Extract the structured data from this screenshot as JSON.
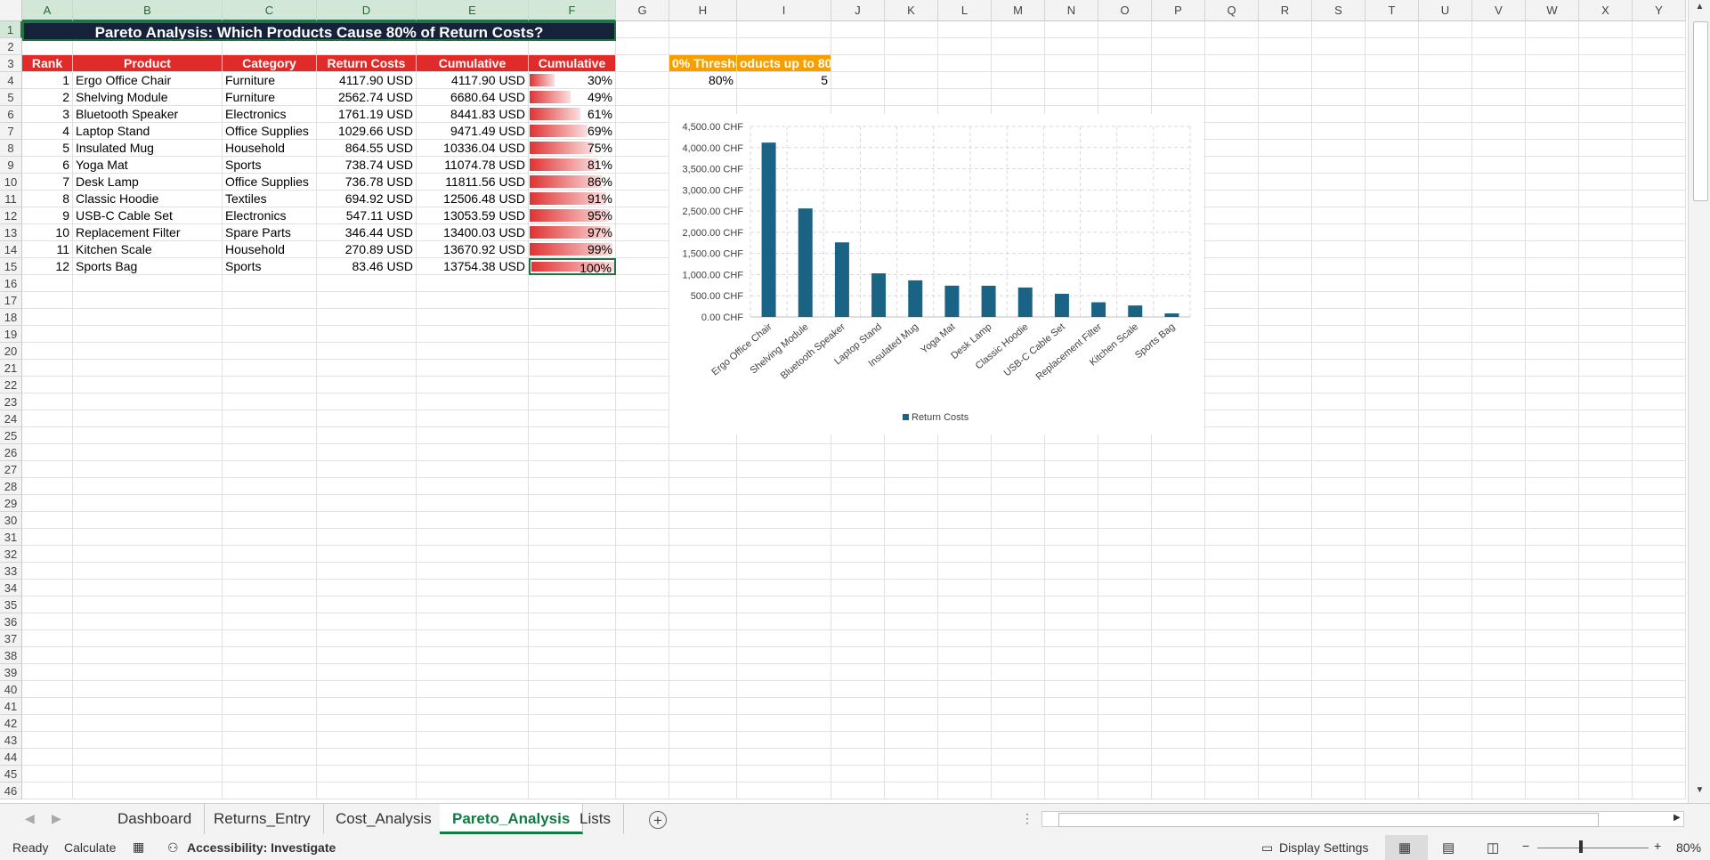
{
  "columns": [
    "A",
    "B",
    "C",
    "D",
    "E",
    "F",
    "G",
    "H",
    "I",
    "J",
    "K",
    "L",
    "M",
    "N",
    "O",
    "P",
    "Q",
    "R",
    "S",
    "T",
    "U",
    "V",
    "W",
    "X",
    "Y"
  ],
  "title": "Pareto Analysis: Which Products Cause 80% of Return Costs?",
  "headers": [
    "Rank",
    "Product",
    "Category",
    "Return Costs",
    "Cumulative",
    "Cumulative"
  ],
  "rows": [
    {
      "rank": "1",
      "product": "Ergo Office Chair",
      "category": "Furniture",
      "cost": "4117.90 USD",
      "cumulative": "4117.90 USD",
      "pct": "30%",
      "pct_value": 0.3
    },
    {
      "rank": "2",
      "product": "Shelving Module",
      "category": "Furniture",
      "cost": "2562.74 USD",
      "cumulative": "6680.64 USD",
      "pct": "49%",
      "pct_value": 0.49
    },
    {
      "rank": "3",
      "product": "Bluetooth Speaker",
      "category": "Electronics",
      "cost": "1761.19 USD",
      "cumulative": "8441.83 USD",
      "pct": "61%",
      "pct_value": 0.61
    },
    {
      "rank": "4",
      "product": "Laptop Stand",
      "category": "Office Supplies",
      "cost": "1029.66 USD",
      "cumulative": "9471.49 USD",
      "pct": "69%",
      "pct_value": 0.69
    },
    {
      "rank": "5",
      "product": "Insulated Mug",
      "category": "Household",
      "cost": "864.55 USD",
      "cumulative": "10336.04 USD",
      "pct": "75%",
      "pct_value": 0.75
    },
    {
      "rank": "6",
      "product": "Yoga Mat",
      "category": "Sports",
      "cost": "738.74 USD",
      "cumulative": "11074.78 USD",
      "pct": "81%",
      "pct_value": 0.81
    },
    {
      "rank": "7",
      "product": "Desk Lamp",
      "category": "Office Supplies",
      "cost": "736.78 USD",
      "cumulative": "11811.56 USD",
      "pct": "86%",
      "pct_value": 0.86
    },
    {
      "rank": "8",
      "product": "Classic Hoodie",
      "category": "Textiles",
      "cost": "694.92 USD",
      "cumulative": "12506.48 USD",
      "pct": "91%",
      "pct_value": 0.91
    },
    {
      "rank": "9",
      "product": "USB-C Cable Set",
      "category": "Electronics",
      "cost": "547.11 USD",
      "cumulative": "13053.59 USD",
      "pct": "95%",
      "pct_value": 0.95
    },
    {
      "rank": "10",
      "product": "Replacement Filter",
      "category": "Spare Parts",
      "cost": "346.44 USD",
      "cumulative": "13400.03 USD",
      "pct": "97%",
      "pct_value": 0.97
    },
    {
      "rank": "11",
      "product": "Kitchen Scale",
      "category": "Household",
      "cost": "270.89 USD",
      "cumulative": "13670.92 USD",
      "pct": "99%",
      "pct_value": 0.99
    },
    {
      "rank": "12",
      "product": "Sports Bag",
      "category": "Sports",
      "cost": "83.46 USD",
      "cumulative": "13754.38 USD",
      "pct": "100%",
      "pct_value": 1.0
    }
  ],
  "threshold": {
    "header_h": "0% Thresho",
    "header_i": "oducts up to 80",
    "value_h": "80%",
    "value_i": "5"
  },
  "colors": {
    "title_bg": "#15223a",
    "header_red": "#e02b2b",
    "header_orange": "#f5a000",
    "bar": "#1b6384",
    "accent": "#107c41"
  },
  "chart_data": {
    "type": "bar",
    "categories": [
      "Ergo Office Chair",
      "Shelving Module",
      "Bluetooth Speaker",
      "Laptop Stand",
      "Insulated Mug",
      "Yoga Mat",
      "Desk Lamp",
      "Classic Hoodie",
      "USB-C Cable Set",
      "Replacement Filter",
      "Kitchen Scale",
      "Sports Bag"
    ],
    "series": [
      {
        "name": "Return Costs",
        "values": [
          4117.9,
          2562.74,
          1761.19,
          1029.66,
          864.55,
          738.74,
          736.78,
          694.92,
          547.11,
          346.44,
          270.89,
          83.46
        ]
      }
    ],
    "y_ticks": [
      "0.00 CHF",
      "500.00 CHF",
      "1,000.00 CHF",
      "1,500.00 CHF",
      "2,000.00 CHF",
      "2,500.00 CHF",
      "3,000.00 CHF",
      "3,500.00 CHF",
      "4,000.00 CHF",
      "4,500.00 CHF"
    ],
    "ylim": [
      0,
      4500
    ],
    "grid": true,
    "legend": "bottom"
  },
  "sheet_tabs": [
    "Dashboard",
    "Returns_Entry",
    "Cost_Analysis",
    "Pareto_Analysis",
    "Lists"
  ],
  "active_tab": "Pareto_Analysis",
  "status": {
    "ready": "Ready",
    "calculate": "Calculate",
    "accessibility": "Accessibility: Investigate",
    "display_settings": "Display Settings",
    "zoom": "80%",
    "zoom_value": 0.8
  }
}
